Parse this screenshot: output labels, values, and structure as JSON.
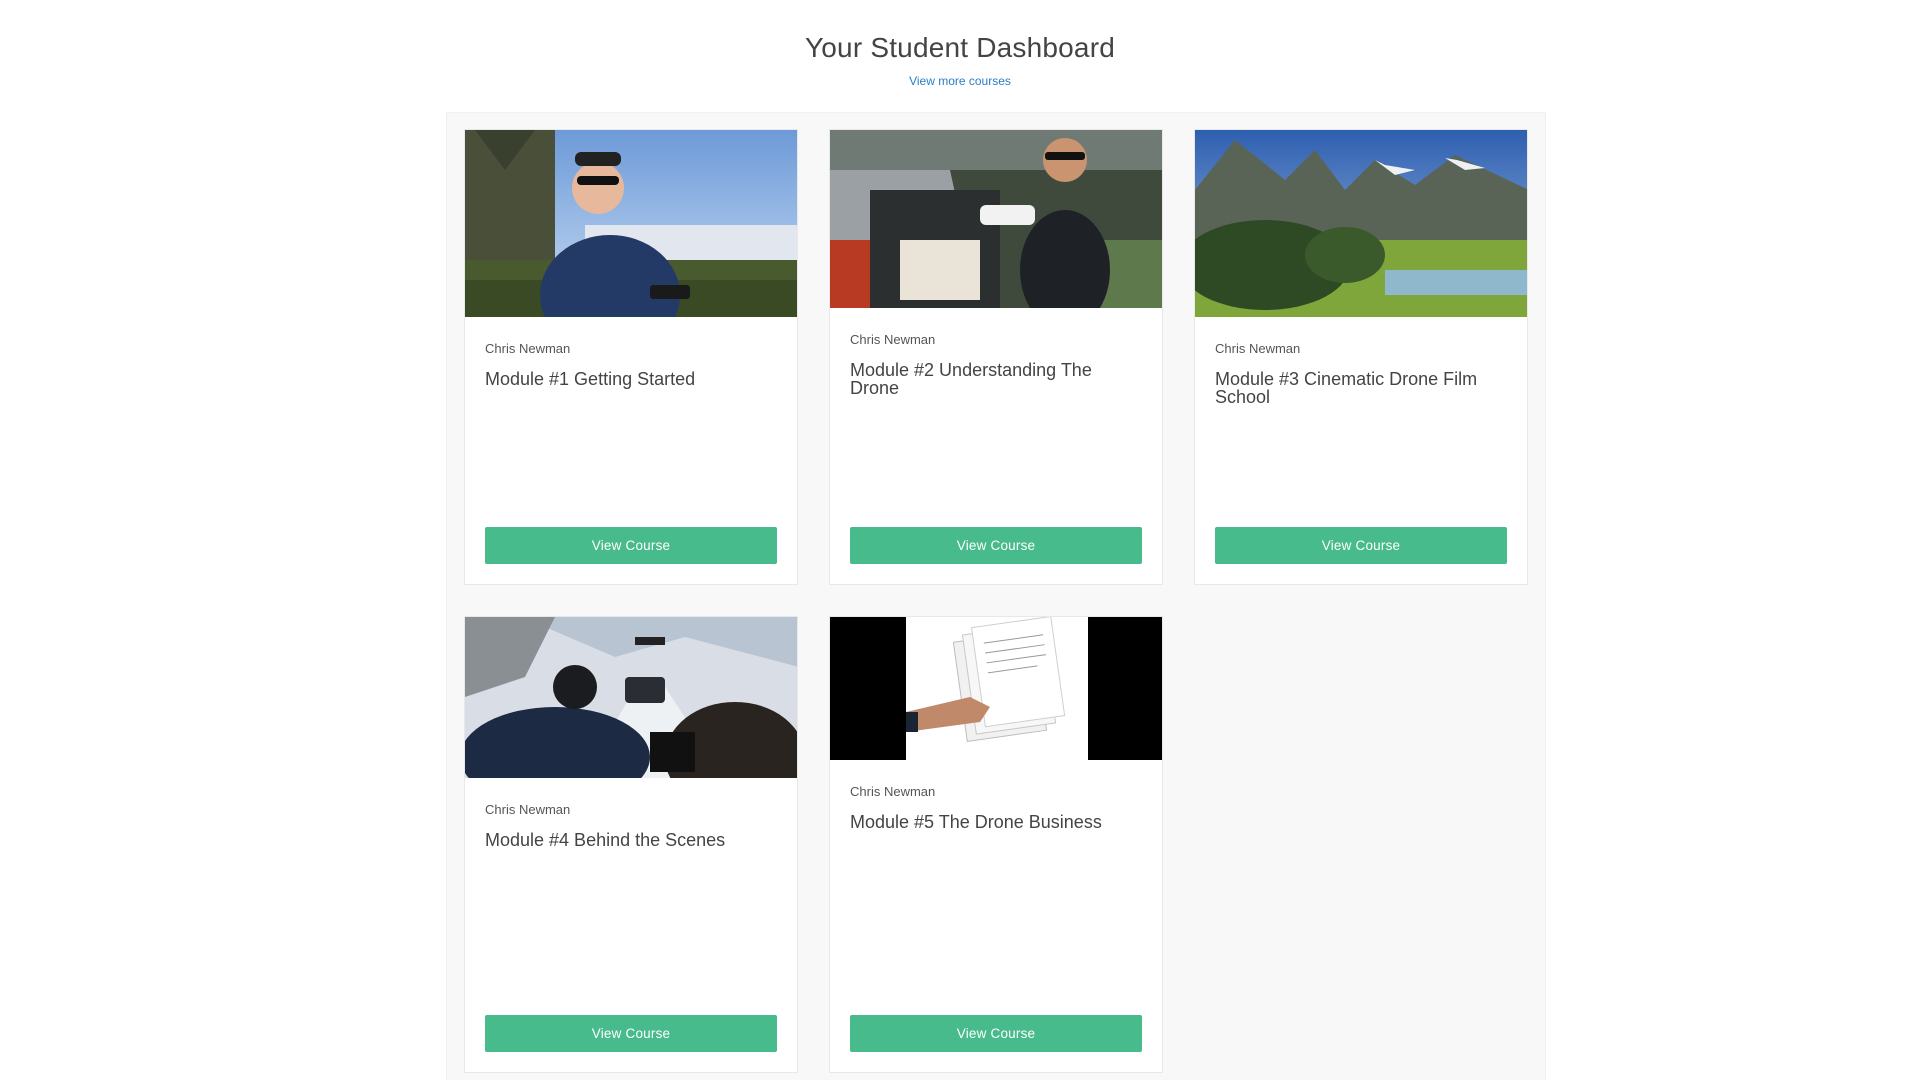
{
  "header": {
    "title": "Your Student Dashboard",
    "more_link": "View more courses"
  },
  "courses": [
    {
      "author": "Chris Newman",
      "title": "Module #1 Getting Started",
      "button": "View Course"
    },
    {
      "author": "Chris Newman",
      "title": "Module #2 Understanding The Drone",
      "button": "View Course"
    },
    {
      "author": "Chris Newman",
      "title": "Module #3 Cinematic Drone Film School",
      "button": "View Course"
    },
    {
      "author": "Chris Newman",
      "title": "Module #4 Behind the Scenes",
      "button": "View Course"
    },
    {
      "author": "Chris Newman",
      "title": "Module #5 The Drone Business",
      "button": "View Course"
    }
  ],
  "colors": {
    "button": "#48bb8c",
    "link": "#2a7ec8",
    "panel": "#f8f8f8"
  }
}
